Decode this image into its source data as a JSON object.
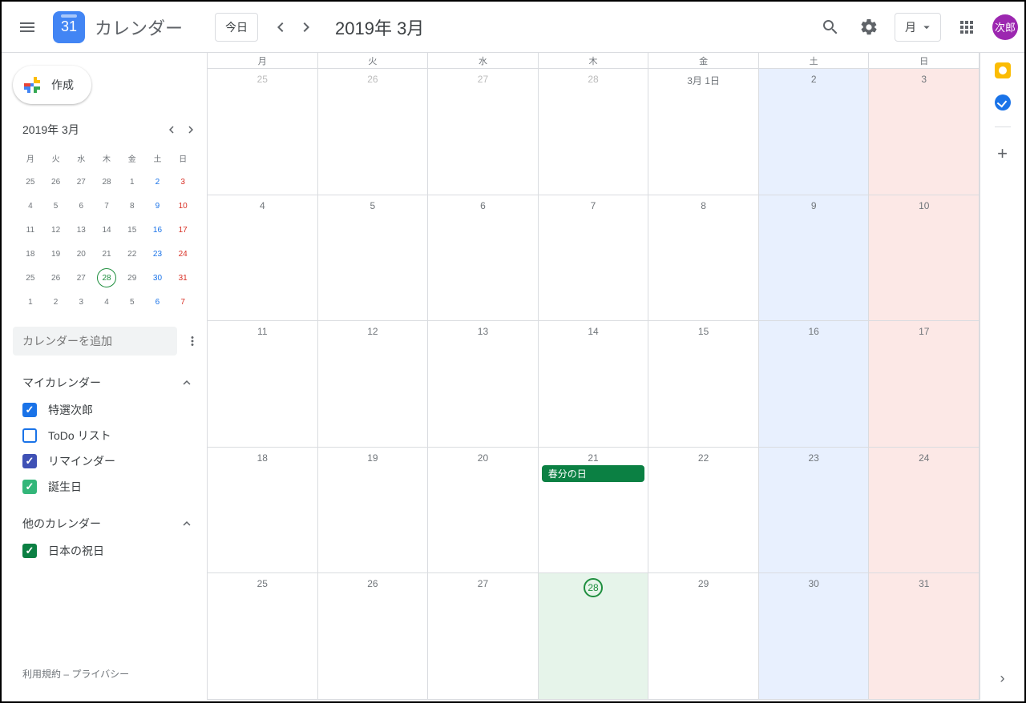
{
  "header": {
    "logo_day": "31",
    "app_title": "カレンダー",
    "today_label": "今日",
    "date_range": "2019年 3月",
    "view_label": "月",
    "avatar_text": "次郎"
  },
  "sidebar": {
    "create_label": "作成",
    "mini_title": "2019年 3月",
    "mini_dow": [
      "月",
      "火",
      "水",
      "木",
      "金",
      "土",
      "日"
    ],
    "mini_days": [
      [
        {
          "n": "25"
        },
        {
          "n": "26"
        },
        {
          "n": "27"
        },
        {
          "n": "28"
        },
        {
          "n": "1"
        },
        {
          "n": "2",
          "c": "sat"
        },
        {
          "n": "3",
          "c": "sun"
        }
      ],
      [
        {
          "n": "4"
        },
        {
          "n": "5"
        },
        {
          "n": "6"
        },
        {
          "n": "7"
        },
        {
          "n": "8"
        },
        {
          "n": "9",
          "c": "sat"
        },
        {
          "n": "10",
          "c": "sun"
        }
      ],
      [
        {
          "n": "11"
        },
        {
          "n": "12"
        },
        {
          "n": "13"
        },
        {
          "n": "14"
        },
        {
          "n": "15"
        },
        {
          "n": "16",
          "c": "sat"
        },
        {
          "n": "17",
          "c": "sun"
        }
      ],
      [
        {
          "n": "18"
        },
        {
          "n": "19"
        },
        {
          "n": "20"
        },
        {
          "n": "21"
        },
        {
          "n": "22"
        },
        {
          "n": "23",
          "c": "sat"
        },
        {
          "n": "24",
          "c": "sun"
        }
      ],
      [
        {
          "n": "25"
        },
        {
          "n": "26"
        },
        {
          "n": "27"
        },
        {
          "n": "28",
          "today": true
        },
        {
          "n": "29"
        },
        {
          "n": "30",
          "c": "sat"
        },
        {
          "n": "31",
          "c": "sun"
        }
      ],
      [
        {
          "n": "1"
        },
        {
          "n": "2"
        },
        {
          "n": "3"
        },
        {
          "n": "4"
        },
        {
          "n": "5"
        },
        {
          "n": "6",
          "c": "sat"
        },
        {
          "n": "7",
          "c": "sun"
        }
      ]
    ],
    "add_cal_placeholder": "カレンダーを追加",
    "my_cal_title": "マイカレンダー",
    "my_cals": [
      {
        "label": "特選次郎",
        "color": "#1a73e8",
        "checked": true
      },
      {
        "label": "ToDo リスト",
        "color": "#1a73e8",
        "checked": false
      },
      {
        "label": "リマインダー",
        "color": "#3f51b5",
        "checked": true
      },
      {
        "label": "誕生日",
        "color": "#33b679",
        "checked": true
      }
    ],
    "other_cal_title": "他のカレンダー",
    "other_cals": [
      {
        "label": "日本の祝日",
        "color": "#0b8043",
        "checked": true
      }
    ],
    "footer_terms": "利用規約",
    "footer_sep": " – ",
    "footer_privacy": "プライバシー"
  },
  "grid": {
    "dow": [
      "月",
      "火",
      "水",
      "木",
      "金",
      "土",
      "日"
    ],
    "weeks": [
      [
        {
          "n": "25",
          "dim": true
        },
        {
          "n": "26",
          "dim": true
        },
        {
          "n": "27",
          "dim": true
        },
        {
          "n": "28",
          "dim": true
        },
        {
          "n": "3月 1日"
        },
        {
          "n": "2",
          "bg": "sat-bg"
        },
        {
          "n": "3",
          "bg": "sun-bg"
        }
      ],
      [
        {
          "n": "4"
        },
        {
          "n": "5"
        },
        {
          "n": "6"
        },
        {
          "n": "7"
        },
        {
          "n": "8"
        },
        {
          "n": "9",
          "bg": "sat-bg"
        },
        {
          "n": "10",
          "bg": "sun-bg"
        }
      ],
      [
        {
          "n": "11"
        },
        {
          "n": "12"
        },
        {
          "n": "13"
        },
        {
          "n": "14"
        },
        {
          "n": "15"
        },
        {
          "n": "16",
          "bg": "sat-bg"
        },
        {
          "n": "17",
          "bg": "sun-bg"
        }
      ],
      [
        {
          "n": "18"
        },
        {
          "n": "19"
        },
        {
          "n": "20"
        },
        {
          "n": "21",
          "events": [
            {
              "title": "春分の日"
            }
          ]
        },
        {
          "n": "22"
        },
        {
          "n": "23",
          "bg": "sat-bg"
        },
        {
          "n": "24",
          "bg": "sun-bg"
        }
      ],
      [
        {
          "n": "25"
        },
        {
          "n": "26"
        },
        {
          "n": "27"
        },
        {
          "n": "28",
          "today": true,
          "bg": "today-bg"
        },
        {
          "n": "29"
        },
        {
          "n": "30",
          "bg": "sat-bg"
        },
        {
          "n": "31",
          "bg": "sun-bg"
        }
      ]
    ]
  }
}
